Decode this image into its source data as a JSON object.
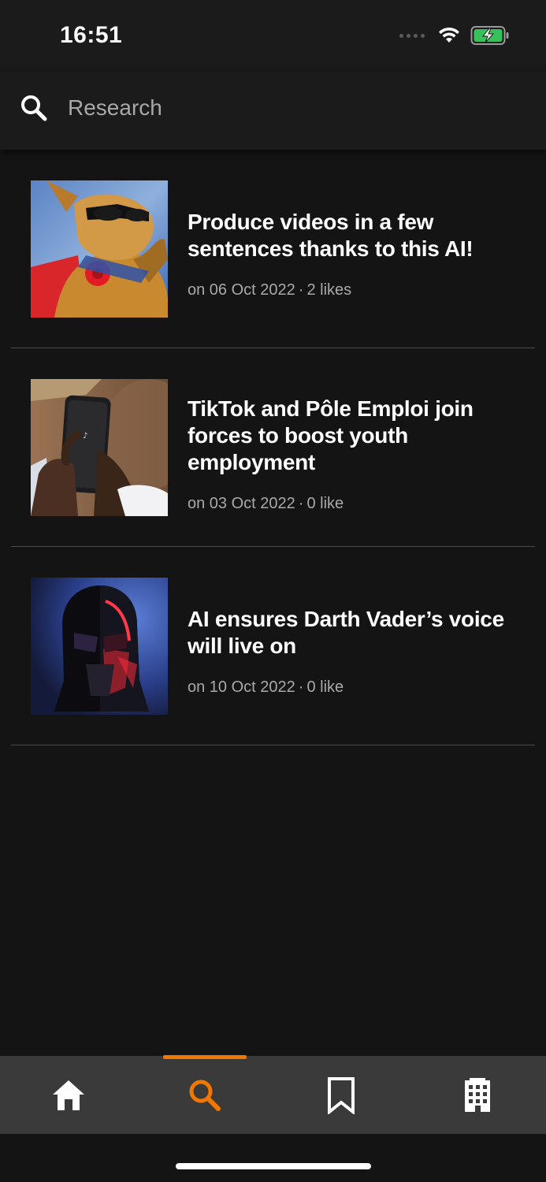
{
  "status_bar": {
    "time": "16:51"
  },
  "search": {
    "placeholder": "Research",
    "value": ""
  },
  "articles": [
    {
      "title": "Produce videos in a few sentences thanks to this AI!",
      "date": "on 06 Oct 2022",
      "likes": "2 likes",
      "thumbnail": "dog-with-sunglasses-image"
    },
    {
      "title": "TikTok and Pôle Emploi join forces to boost youth employment",
      "date": "on 03 Oct 2022",
      "likes": "0 like",
      "thumbnail": "hand-holding-phone-tiktok-image"
    },
    {
      "title": "AI ensures Darth Vader’s voice will live on",
      "date": "on 10 Oct 2022",
      "likes": "0 like",
      "thumbnail": "darth-vader-helmet-image"
    }
  ],
  "tab_bar": {
    "active": "search",
    "tabs": [
      "home-icon",
      "search-icon",
      "bookmark-icon",
      "building-icon"
    ]
  },
  "colors": {
    "accent": "#f07800",
    "background": "#141414",
    "header": "#1b1b1b",
    "tab_bar": "#3a3a3a"
  },
  "separator": "·"
}
